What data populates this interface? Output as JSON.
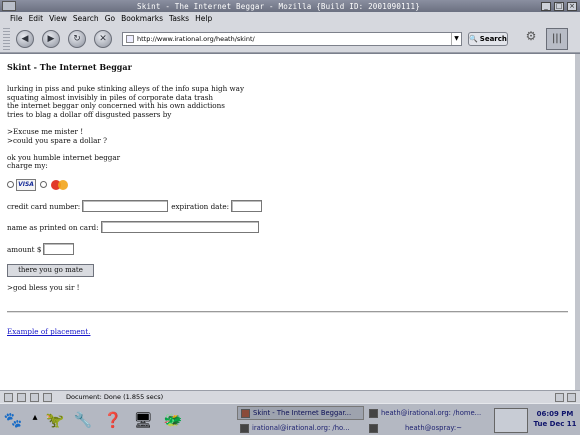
{
  "window": {
    "title": "Skint - The Internet Beggar - Mozilla {Build ID: 2001090111}",
    "controls": [
      "_",
      "□",
      "×"
    ]
  },
  "menu": [
    "File",
    "Edit",
    "View",
    "Search",
    "Go",
    "Bookmarks",
    "Tasks",
    "Help"
  ],
  "nav": {
    "back_icon": "back-arrow-icon",
    "forward_icon": "forward-arrow-icon",
    "reload_icon": "reload-icon",
    "stop_icon": "stop-icon",
    "url": "http://www.irational.org/heath/skint/",
    "search_label": "Search"
  },
  "page": {
    "heading": "Skint - The Internet Beggar",
    "poem": [
      "lurking in piss and puke stinking alleys of the info supa high way",
      "squating almost invisibly in piles of corporate data trash",
      "the internet beggar only concerned with his own addictions",
      "tries to blag a dollar off disgusted passers by"
    ],
    "plea": [
      ">Excuse me mister !",
      ">could you spare a dollar ?"
    ],
    "prompt": [
      "ok you humble internet beggar",
      "charge my:"
    ],
    "card_visa": "VISA",
    "labels": {
      "cc_number": "credit card number:",
      "expiry": "expiration date:",
      "name": "name as printed on card:",
      "amount": "amount $"
    },
    "submit": "there you go mate",
    "blessing": ">god bless you sir !",
    "link": "Example of placement."
  },
  "status": {
    "text": "Document: Done (1.855 secs)"
  },
  "taskbar": {
    "tasks": [
      "Skint - The Internet Beggar...",
      "heath@irational.org: /home...",
      "irational@irational.org: /ho...",
      "heath@ospray:~"
    ],
    "time": "06:09 PM",
    "date": "Tue Dec 11"
  }
}
